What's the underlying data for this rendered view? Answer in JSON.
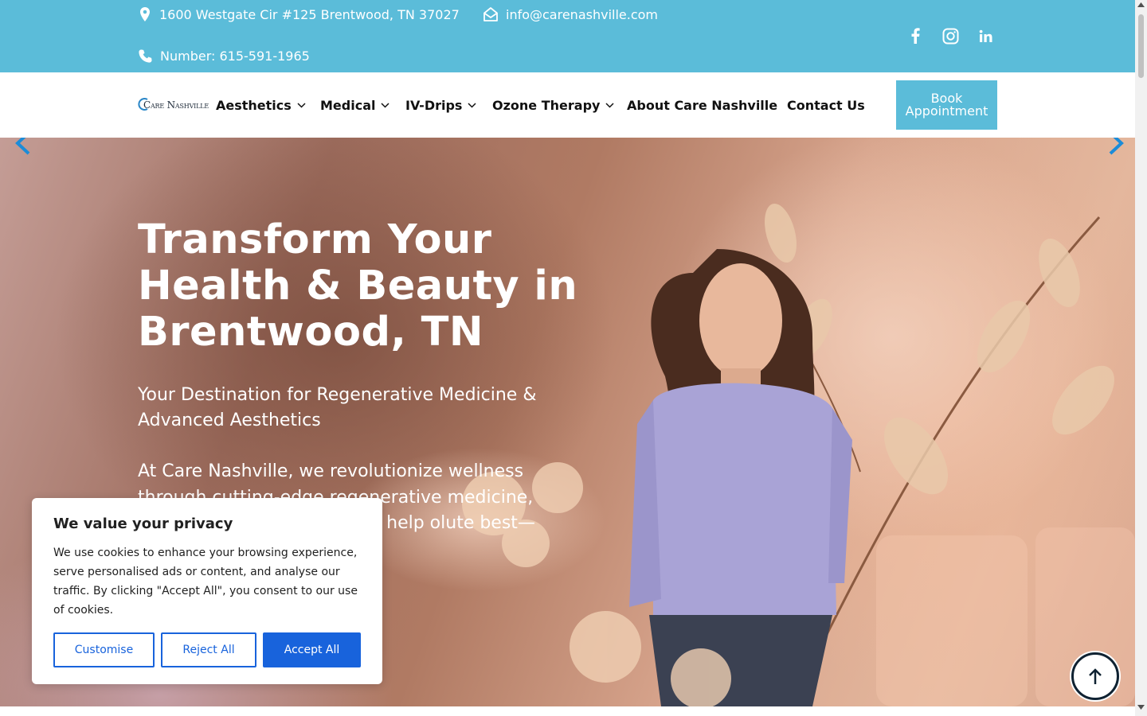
{
  "topbar": {
    "address": "1600 Westgate Cir #125 Brentwood, TN 37027",
    "email": "info@carenashville.com",
    "phone": "Number: 615-591-1965",
    "social": [
      "facebook-icon",
      "instagram-icon",
      "linkedin-icon"
    ],
    "bg_color": "#5bbcd9"
  },
  "nav": {
    "logo_text": "Care Nashville",
    "items": [
      {
        "label": "Aesthetics",
        "has_dropdown": true
      },
      {
        "label": "Medical",
        "has_dropdown": true
      },
      {
        "label": "IV-Drips",
        "has_dropdown": true
      },
      {
        "label": "Ozone Therapy",
        "has_dropdown": true
      },
      {
        "label": "About Care Nashville",
        "has_dropdown": false
      },
      {
        "label": "Contact Us",
        "has_dropdown": false
      }
    ],
    "book_label": "Book Appointment"
  },
  "hero": {
    "title": "Transform Your Health & Beauty in Brentwood, TN",
    "subtitle": "Your Destination for Regenerative Medicine & Advanced Aesthetics",
    "body": "At Care Nashville, we revolutionize wellness through cutting-edge regenerative medicine, reatments, and designed to help olute best—inside"
  },
  "cookie": {
    "title": "We value your privacy",
    "text": "We use cookies to enhance your browsing experience, serve personalised ads or content, and analyse our traffic. By clicking \"Accept All\", you consent to our use of cookies.",
    "customise_label": "Customise",
    "reject_label": "Reject All",
    "accept_label": "Accept All",
    "accent_color": "#1863dc"
  }
}
